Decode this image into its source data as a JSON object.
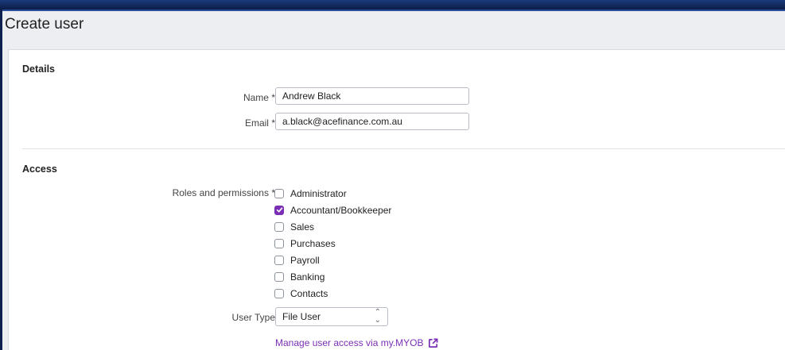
{
  "page": {
    "title": "Create user"
  },
  "details": {
    "section_title": "Details",
    "name": {
      "label": "Name",
      "required": "*",
      "value": "Andrew Black"
    },
    "email": {
      "label": "Email",
      "required": "*",
      "value": "a.black@acefinance.com.au"
    }
  },
  "access": {
    "section_title": "Access",
    "roles_label": "Roles and permissions",
    "roles_required": "*",
    "roles": [
      {
        "label": "Administrator",
        "checked": false
      },
      {
        "label": "Accountant/Bookkeeper",
        "checked": true
      },
      {
        "label": "Sales",
        "checked": false
      },
      {
        "label": "Purchases",
        "checked": false
      },
      {
        "label": "Payroll",
        "checked": false
      },
      {
        "label": "Banking",
        "checked": false
      },
      {
        "label": "Contacts",
        "checked": false
      }
    ],
    "user_type_label": "User Type",
    "user_type_value": "File User",
    "manage_link": "Manage user access via my.MYOB",
    "accent_color": "#7b2fb5"
  }
}
